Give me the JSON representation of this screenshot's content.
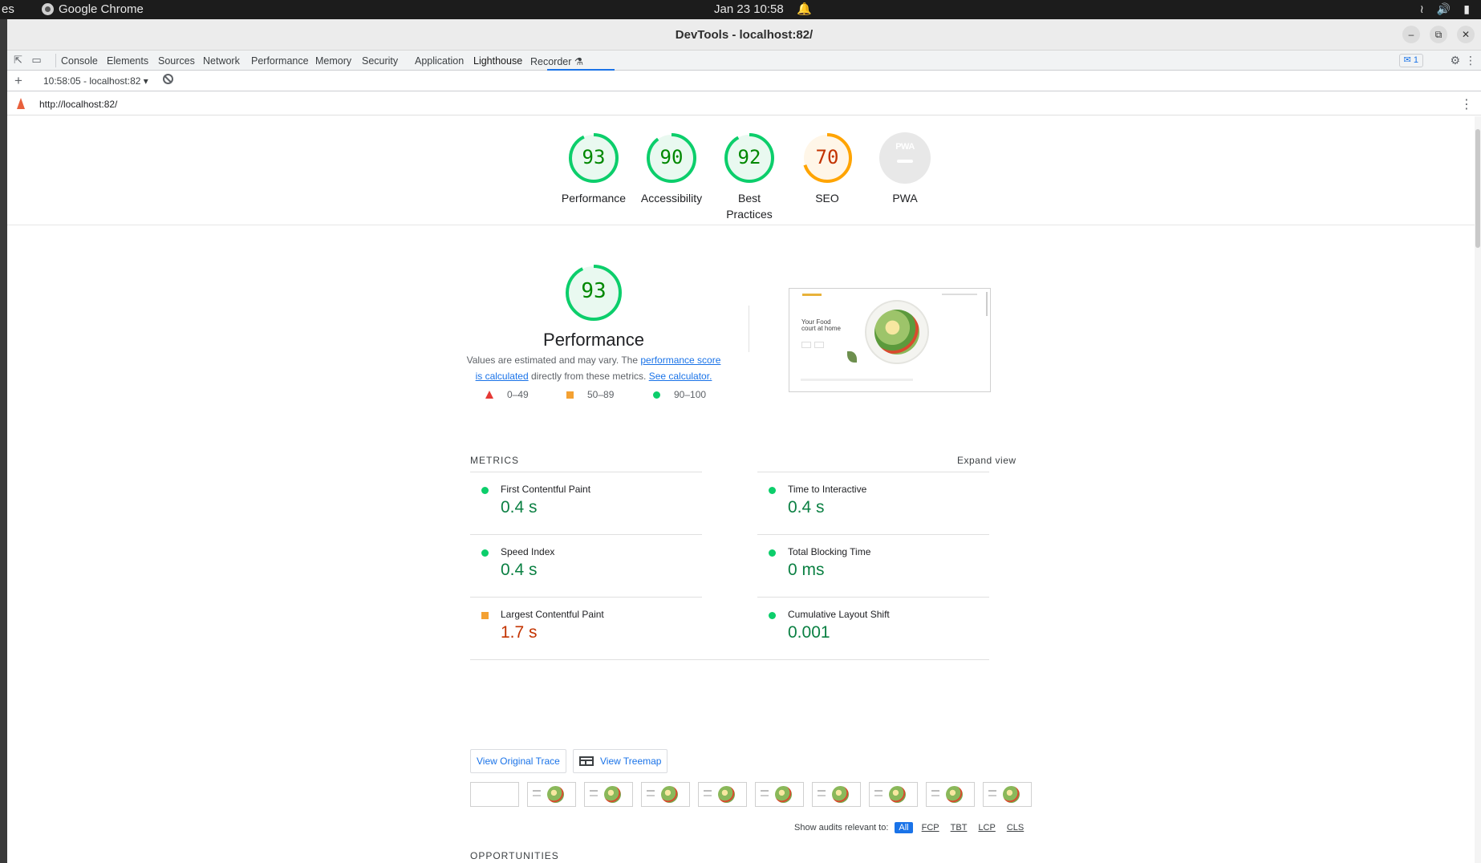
{
  "os": {
    "left_cut": "es",
    "app_name": "Google Chrome",
    "clock": "Jan 23  10:58"
  },
  "window": {
    "title": "DevTools - localhost:82/"
  },
  "tabs": [
    "Console",
    "Elements",
    "Sources",
    "Network",
    "Performance",
    "Memory",
    "Security",
    "Application",
    "Lighthouse",
    "Recorder"
  ],
  "active_tab": "Lighthouse",
  "issues_count": "1",
  "report_bar": {
    "selected_report": "10:58:05 - localhost:82"
  },
  "url": "http://localhost:82/",
  "scores": [
    {
      "label": "Performance",
      "value": "93",
      "color": "#0cce6b"
    },
    {
      "label": "Accessibility",
      "value": "90",
      "color": "#0cce6b"
    },
    {
      "label": "Best Practices",
      "value": "92",
      "color": "#0cce6b"
    },
    {
      "label": "SEO",
      "value": "70",
      "color": "#ffa400"
    },
    {
      "label": "PWA",
      "value": "PWA",
      "color": "#cccccc"
    }
  ],
  "performance": {
    "score": "93",
    "title": "Performance",
    "desc_part1": "Values are estimated and may vary. The ",
    "desc_link1": "performance score is calculated",
    "desc_part2": " directly from these metrics. ",
    "desc_link2": "See calculator.",
    "legend": [
      "0–49",
      "50–89",
      "90–100"
    ]
  },
  "screenshot_text": "Your Food court at home",
  "metrics": {
    "heading": "METRICS",
    "expand": "Expand view",
    "items": [
      {
        "title": "First Contentful Paint",
        "value": "0.4 s",
        "rating": "pass"
      },
      {
        "title": "Time to Interactive",
        "value": "0.4 s",
        "rating": "pass"
      },
      {
        "title": "Speed Index",
        "value": "0.4 s",
        "rating": "pass"
      },
      {
        "title": "Total Blocking Time",
        "value": "0 ms",
        "rating": "pass"
      },
      {
        "title": "Largest Contentful Paint",
        "value": "1.7 s",
        "rating": "average"
      },
      {
        "title": "Cumulative Layout Shift",
        "value": "0.001",
        "rating": "pass"
      }
    ]
  },
  "buttons": {
    "trace": "View Original Trace",
    "treemap": "View Treemap"
  },
  "filter": {
    "label": "Show audits relevant to:",
    "chips": [
      "All",
      "FCP",
      "TBT",
      "LCP",
      "CLS"
    ]
  },
  "opportunities_heading": "OPPORTUNITIES"
}
